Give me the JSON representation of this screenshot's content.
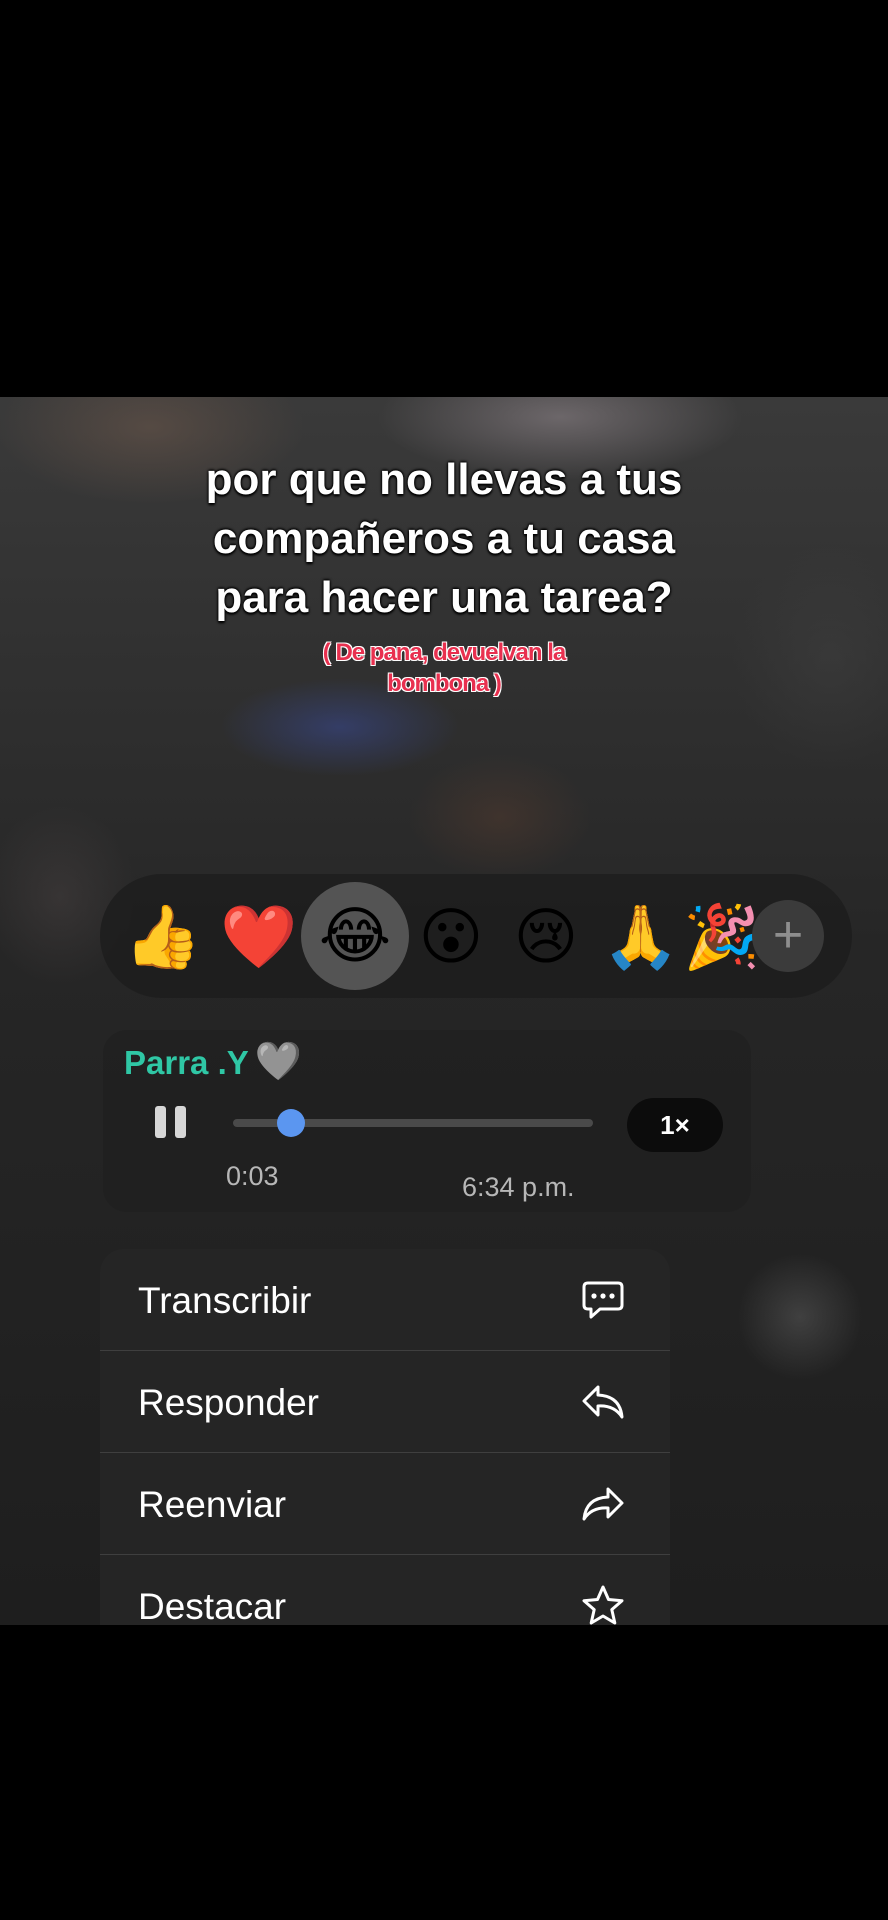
{
  "caption": {
    "lines": [
      "por que no llevas a tus",
      "compañeros a tu casa",
      "para hacer una tarea?"
    ],
    "sub_lines": [
      "( De pana, devuelvan la",
      "bombona )"
    ]
  },
  "reactions": {
    "emojis": [
      "👍",
      "❤️",
      "😂",
      "😮",
      "😢",
      "🙏",
      "🎉"
    ],
    "selected_index": 2,
    "more_symbol": "+"
  },
  "message": {
    "sender": "Parra .Y",
    "sender_emoji": "🩶",
    "elapsed": "0:03",
    "time": "6:34 p.m.",
    "speed": "1×",
    "progress": 0.16,
    "accent": "#2fc7a5",
    "progress_color": "#5b96f0"
  },
  "menu": {
    "items": [
      {
        "label": "Transcribir",
        "icon": "transcribe-icon"
      },
      {
        "label": "Responder",
        "icon": "reply-icon"
      },
      {
        "label": "Reenviar",
        "icon": "forward-icon"
      },
      {
        "label": "Destacar",
        "icon": "star-icon"
      }
    ]
  }
}
